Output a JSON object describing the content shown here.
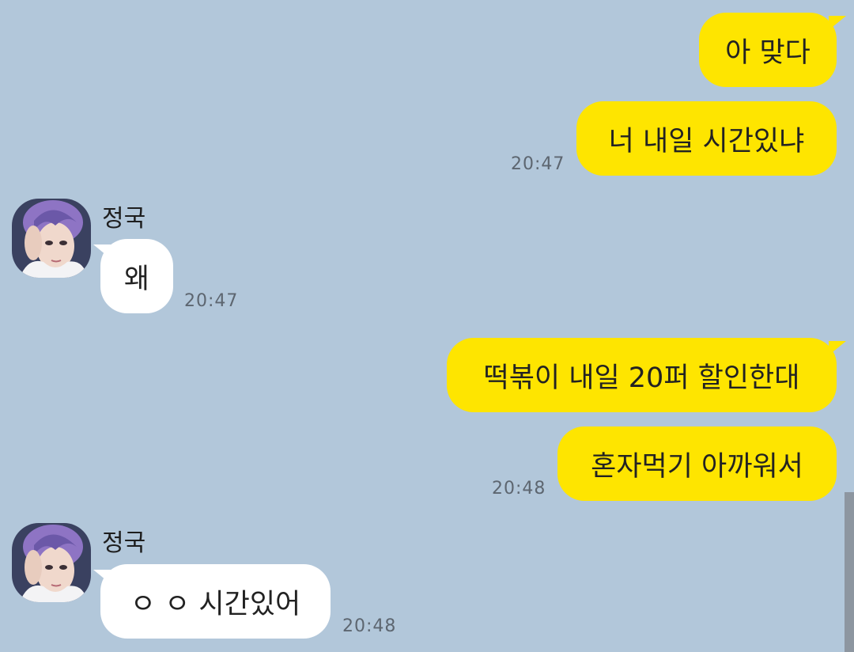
{
  "messages": [
    {
      "sender": "me",
      "text": "아 맞다"
    },
    {
      "sender": "me",
      "text": "너 내일 시간있냐",
      "time": "20:47"
    },
    {
      "sender": "other",
      "name": "정국",
      "text": "왜",
      "time": "20:47"
    },
    {
      "sender": "me",
      "text": "떡볶이 내일 20퍼 할인한대"
    },
    {
      "sender": "me",
      "text": "혼자먹기 아까워서",
      "time": "20:48"
    },
    {
      "sender": "other",
      "name": "정국",
      "text": "ㅇ ㅇ 시간있어",
      "time": "20:48"
    }
  ],
  "colors": {
    "background": "#b2c7da",
    "my_bubble": "#fee500",
    "other_bubble": "#ffffff",
    "time_text": "#5d6670"
  },
  "icons": {
    "avatar": "profile-photo-avatar"
  }
}
